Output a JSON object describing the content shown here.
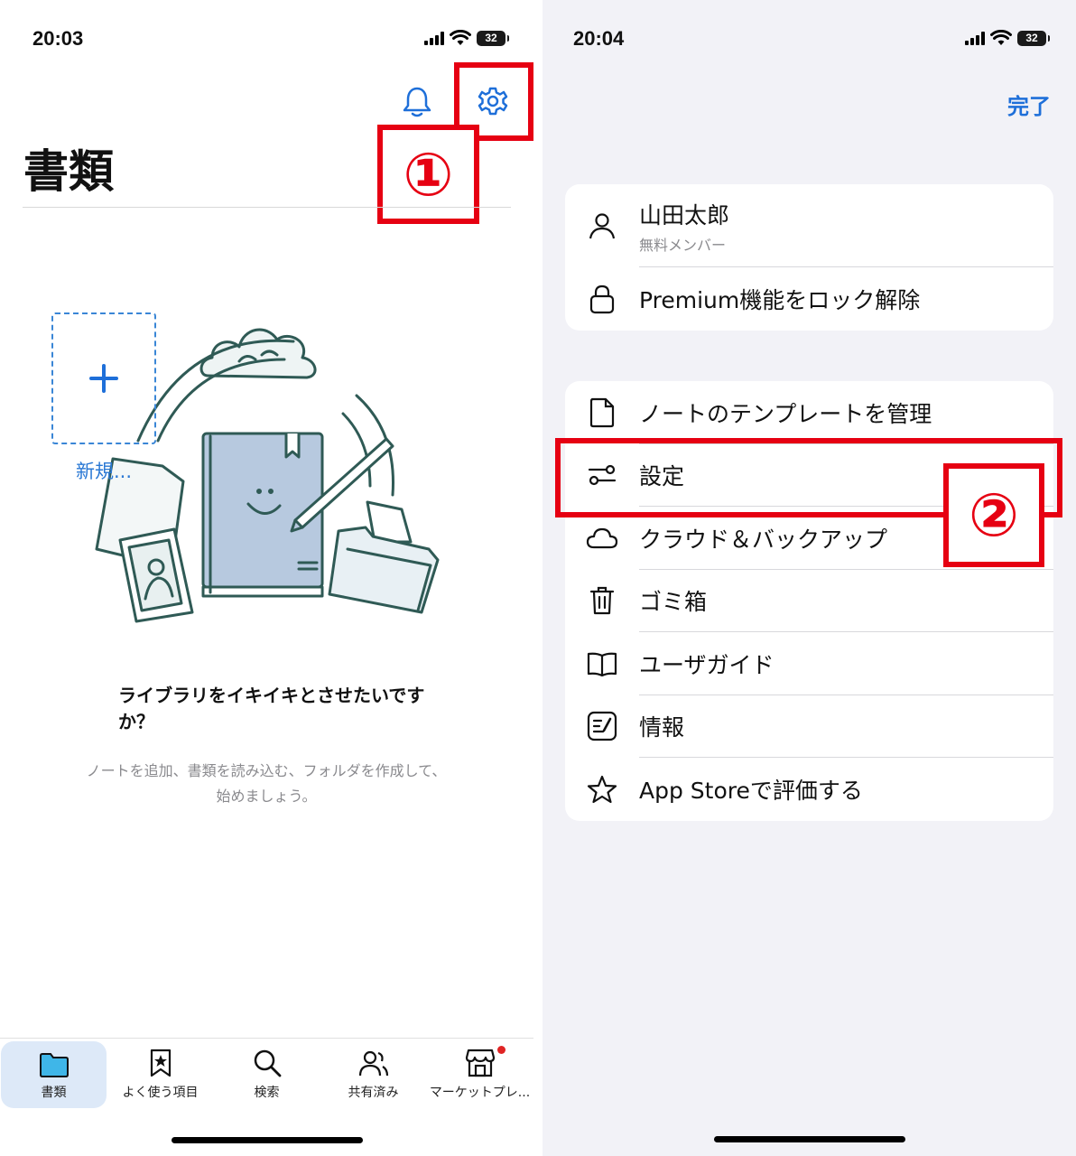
{
  "left": {
    "status": {
      "time": "20:03",
      "battery": "32"
    },
    "title": "書類",
    "new_label": "新規...",
    "annotation": "①",
    "empty": {
      "title": "ライブラリをイキイキとさせたいですか？",
      "desc": "ノートを追加、書類を読み込む、フォルダを作成して、始めましょう。"
    },
    "tabs": [
      {
        "label": "書類",
        "icon": "folder-icon"
      },
      {
        "label": "よく使う項目",
        "icon": "bookmark-star-icon"
      },
      {
        "label": "検索",
        "icon": "search-icon"
      },
      {
        "label": "共有済み",
        "icon": "people-icon"
      },
      {
        "label": "マーケットプレ...",
        "icon": "store-icon"
      }
    ]
  },
  "right": {
    "status": {
      "time": "20:04",
      "battery": "32"
    },
    "done": "完了",
    "annotation": "②",
    "account": {
      "name": "山田太郎",
      "membership": "無料メンバー",
      "unlock": "Premium機能をロック解除"
    },
    "menu": [
      {
        "label": "ノートのテンプレートを管理",
        "icon": "document-icon"
      },
      {
        "label": "設定",
        "icon": "sliders-icon"
      },
      {
        "label": "クラウド＆バックアップ",
        "icon": "cloud-icon"
      },
      {
        "label": "ゴミ箱",
        "icon": "trash-icon"
      },
      {
        "label": "ユーザガイド",
        "icon": "book-icon"
      },
      {
        "label": "情報",
        "icon": "info-note-icon"
      },
      {
        "label": "App Storeで評価する",
        "icon": "star-icon"
      }
    ]
  },
  "colors": {
    "accent": "#1e6fd9",
    "annotation": "#e60012",
    "illustration": "#2f5a55"
  }
}
